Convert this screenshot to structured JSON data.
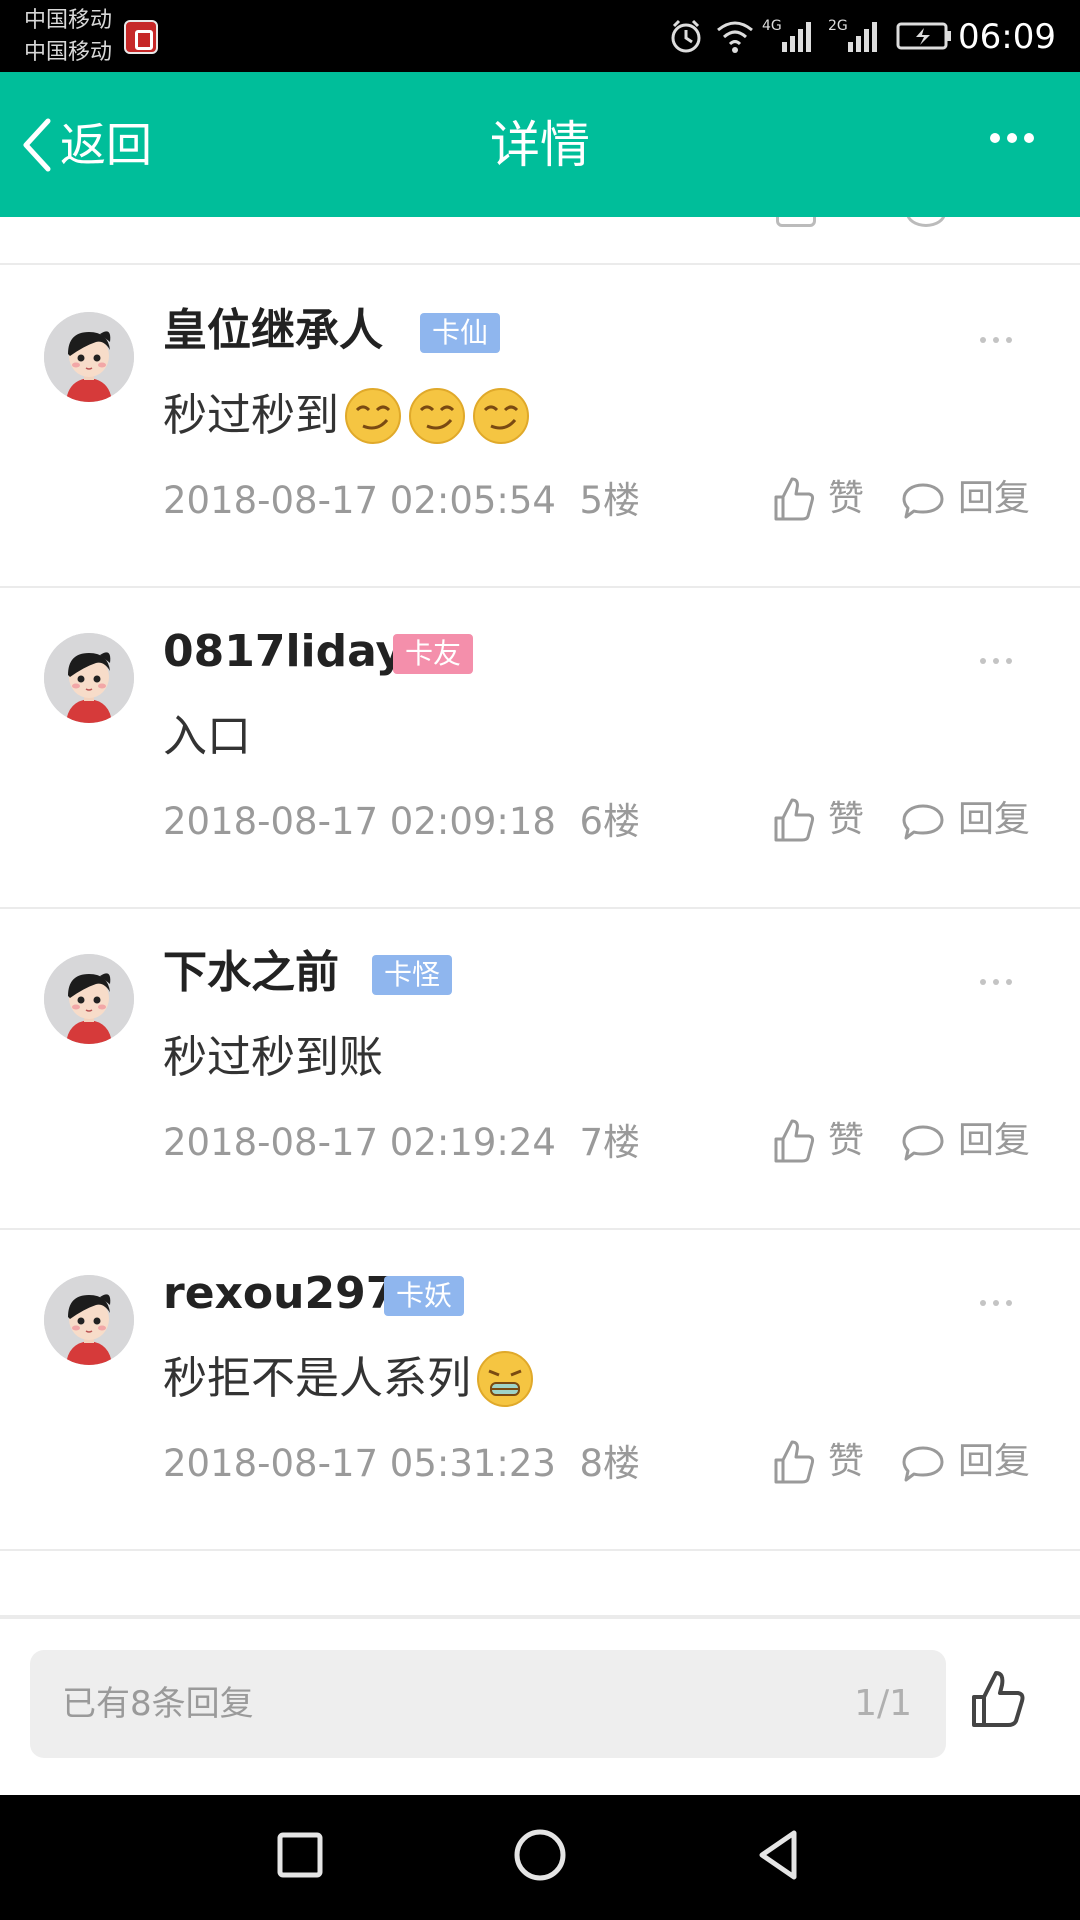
{
  "status_bar": {
    "carrier_1": "中国移动",
    "carrier_2": "中国移动",
    "network_1": "4G",
    "network_2": "2G",
    "time": "06:09",
    "icons": [
      "alarm-icon",
      "wifi-icon",
      "signal-icon",
      "battery-charging-icon"
    ]
  },
  "header": {
    "back_label": "返回",
    "title": "详情",
    "more_icon": "more-icon",
    "background_color": "#00be9a"
  },
  "comments": [
    {
      "username": "皇位继承人",
      "badge": "卡仙",
      "badge_color": "#8fb6ee",
      "text": "秒过秒到",
      "emojis": [
        "smirk-emoji",
        "smirk-emoji",
        "smirk-emoji"
      ],
      "timestamp": "2018-08-17 02:05:54",
      "floor": "5楼",
      "like_label": "赞",
      "reply_label": "回复"
    },
    {
      "username": "0817liday",
      "badge": "卡友",
      "badge_color": "#f48fab",
      "text": "入口",
      "emojis": [],
      "timestamp": "2018-08-17 02:09:18",
      "floor": "6楼",
      "like_label": "赞",
      "reply_label": "回复"
    },
    {
      "username": "下水之前",
      "badge": "卡怪",
      "badge_color": "#8fb6ee",
      "text": "秒过秒到账",
      "emojis": [],
      "timestamp": "2018-08-17 02:19:24",
      "floor": "7楼",
      "like_label": "赞",
      "reply_label": "回复"
    },
    {
      "username": "rexou297",
      "badge": "卡妖",
      "badge_color": "#8fb6ee",
      "text": "秒拒不是人系列",
      "emojis": [
        "grimace-emoji"
      ],
      "timestamp": "2018-08-17 05:31:23",
      "floor": "8楼",
      "like_label": "赞",
      "reply_label": "回复"
    }
  ],
  "bottom_bar": {
    "reply_placeholder": "已有8条回复",
    "page_indicator": "1/1",
    "like_icon": "thumbs-up-icon"
  },
  "nav_bar": {
    "buttons": [
      "recent-apps-icon",
      "home-icon",
      "back-icon"
    ]
  }
}
